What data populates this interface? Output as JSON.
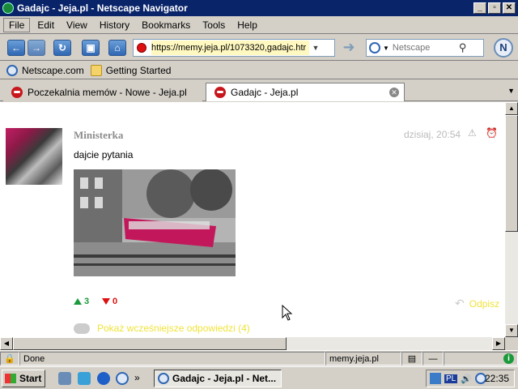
{
  "window": {
    "title": "Gadajc - Jeja.pl - Netscape Navigator",
    "buttons": [
      "_",
      "▫",
      "✕"
    ]
  },
  "menu": [
    "File",
    "Edit",
    "View",
    "History",
    "Bookmarks",
    "Tools",
    "Help"
  ],
  "nav": {
    "url": "https://memy.jeja.pl/1073320,gadajc.htr",
    "search_placeholder": "Netscape"
  },
  "bookmarks": [
    {
      "label": "Netscape.com",
      "icon": "netscape-icon"
    },
    {
      "label": "Getting Started",
      "icon": "folder-icon"
    }
  ],
  "tabs": [
    {
      "label": "Poczekalnia memów - Nowe - Jeja.pl",
      "active": false
    },
    {
      "label": "Gadajc - Jeja.pl",
      "active": true
    }
  ],
  "comment": {
    "author": "Ministerka",
    "time": "dzisiaj, 20:54",
    "text": "dajcie pytania",
    "votes_up": "3",
    "votes_down": "0",
    "reply": "Odpisz",
    "show_earlier": "Pokaż wcześniejsze odpowiedzi (4)"
  },
  "status": {
    "text": "Done",
    "host": "memy.jeja.pl"
  },
  "taskbar": {
    "start": "Start",
    "item": "Gadajc - Jeja.pl - Net...",
    "clock": "22:35",
    "tray_lang": "PL"
  },
  "colors": {
    "titlebar": "#0a246a",
    "link_yellow": "#f0e33a",
    "vote_up": "#1a9a3a",
    "vote_down": "#d11111"
  }
}
